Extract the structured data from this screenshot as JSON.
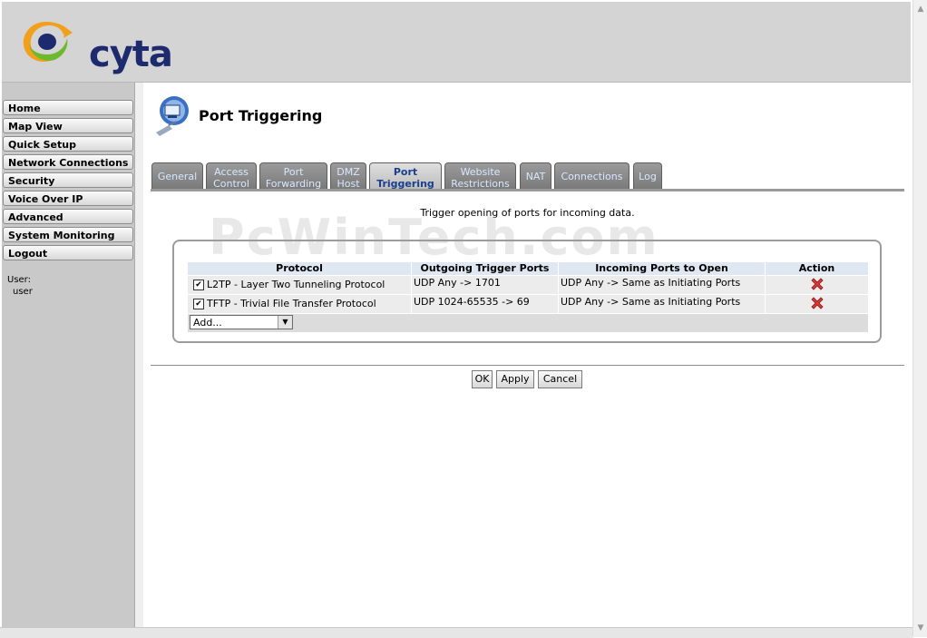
{
  "brand": {
    "name": "cyta"
  },
  "sidebar": {
    "items": [
      {
        "label": "Home"
      },
      {
        "label": "Map View"
      },
      {
        "label": "Quick Setup"
      },
      {
        "label": "Network Connections"
      },
      {
        "label": "Security"
      },
      {
        "label": "Voice Over IP"
      },
      {
        "label": "Advanced"
      },
      {
        "label": "System Monitoring"
      },
      {
        "label": "Logout"
      }
    ],
    "user_label": "User:",
    "user_name": "user"
  },
  "page": {
    "title": "Port Triggering",
    "icon": "port-triggering-icon"
  },
  "tabs": [
    {
      "label": "General"
    },
    {
      "label": "Access\nControl"
    },
    {
      "label": "Port\nForwarding"
    },
    {
      "label": "DMZ\nHost"
    },
    {
      "label": "Port\nTriggering",
      "active": true
    },
    {
      "label": "Website\nRestrictions"
    },
    {
      "label": "NAT"
    },
    {
      "label": "Connections"
    },
    {
      "label": "Log"
    }
  ],
  "description": "Trigger opening of ports for incoming data.",
  "watermark": "PcWinTech.com",
  "table": {
    "headers": [
      "Protocol",
      "Outgoing Trigger Ports",
      "Incoming Ports to Open",
      "Action"
    ],
    "rows": [
      {
        "checked": true,
        "protocol": "L2TP - Layer Two Tunneling Protocol",
        "outgoing": "UDP Any -> 1701",
        "incoming": "UDP Any -> Same as Initiating Ports",
        "action_icon": "delete-icon"
      },
      {
        "checked": true,
        "protocol": "TFTP - Trivial File Transfer Protocol",
        "outgoing": "UDP 1024-65535 -> 69",
        "incoming": "UDP Any -> Same as Initiating Ports",
        "action_icon": "delete-icon"
      }
    ],
    "add_select": "Add..."
  },
  "buttons": {
    "ok": "OK",
    "apply": "Apply",
    "cancel": "Cancel"
  },
  "colors": {
    "brand_navy": "#1d2a6e",
    "tab_text": "#d8e8ff",
    "active_tab_text": "#1a3f8c",
    "delete_red": "#d93a3a"
  }
}
